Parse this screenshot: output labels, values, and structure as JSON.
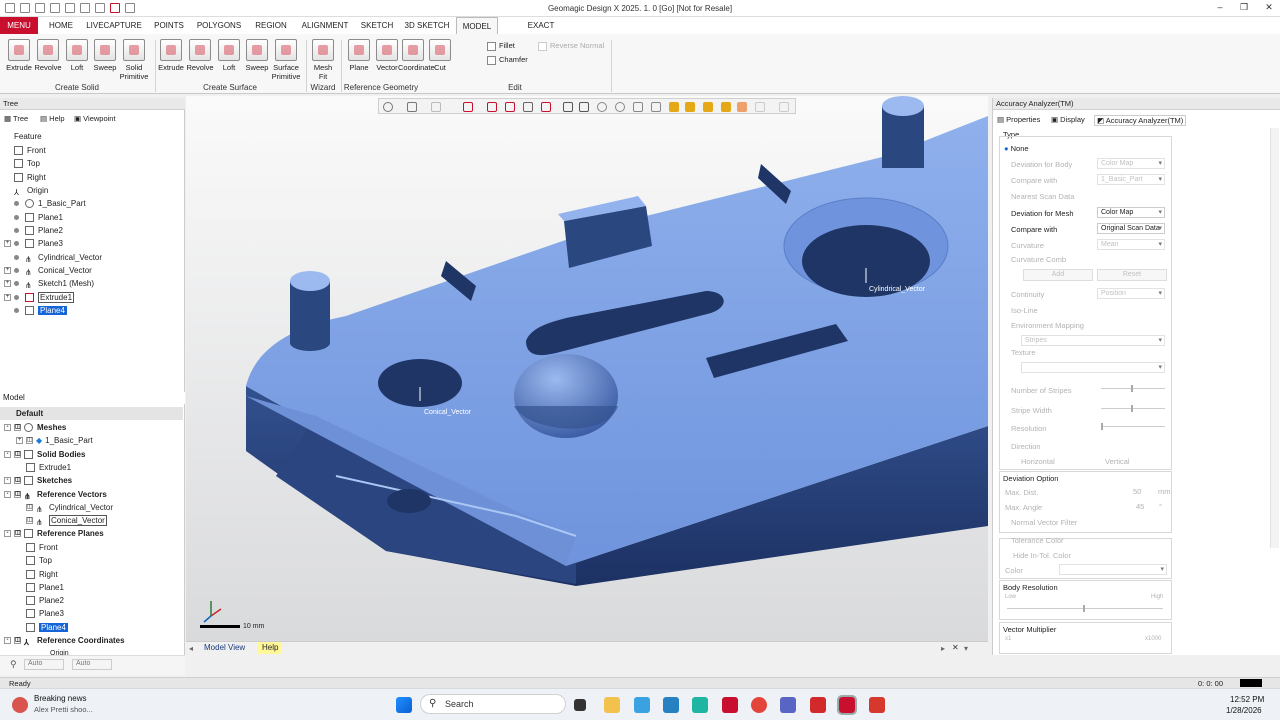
{
  "app": {
    "title": "Geomagic Design X 2025. 1. 0 [Go] [Not for Resale]",
    "window_controls": {
      "minimize": "–",
      "maximize": "❐",
      "close": "✕"
    }
  },
  "tabs": {
    "menu": "MENU",
    "items": [
      "HOME",
      "LIVECAPTURE",
      "POINTS",
      "POLYGONS",
      "REGION",
      "ALIGNMENT",
      "SKETCH",
      "3D SKETCH",
      "MODEL",
      "EXACT SURFACING"
    ],
    "active": "MODEL"
  },
  "ribbon": {
    "create_solid": {
      "label": "Create Solid",
      "buttons": [
        "Extrude",
        "Revolve",
        "Loft",
        "Sweep",
        "Solid\nPrimitive"
      ]
    },
    "create_surface": {
      "label": "Create Surface",
      "buttons": [
        "Extrude",
        "Revolve",
        "Loft",
        "Sweep",
        "Surface\nPrimitive"
      ]
    },
    "wizard": {
      "label": "Wizard",
      "buttons": [
        "Mesh\nFit"
      ]
    },
    "reference_geometry": {
      "label": "Reference Geometry",
      "buttons": [
        "Plane",
        "Vector",
        "Coordinate",
        "Cut"
      ]
    },
    "edit": {
      "label": "Edit",
      "fillet": "Fillet",
      "chamfer": "Chamfer",
      "reverse_normal": "Reverse Normal"
    }
  },
  "left_panel": {
    "title": "Tree",
    "subtabs": [
      "Tree",
      "Help",
      "Viewpoint"
    ],
    "feature_label": "Feature",
    "feature_items": [
      "Front",
      "Top",
      "Right",
      "Origin",
      "1_Basic_Part",
      "Plane1",
      "Plane2",
      "Plane3",
      "Cylindrical_Vector",
      "Conical_Vector",
      "Sketch1 (Mesh)",
      "Extrude1",
      "Plane4"
    ],
    "model_label": "Model",
    "model_items": {
      "default": "Default",
      "meshes": "Meshes",
      "mesh_child": "1_Basic_Part",
      "solid_bodies": "Solid Bodies",
      "solid_child": "Extrude1",
      "sketches": "Sketches",
      "reference_vectors": "Reference Vectors",
      "vec1": "Cylindrical_Vector",
      "vec2": "Conical_Vector",
      "reference_planes": "Reference Planes",
      "planes": [
        "Front",
        "Top",
        "Right",
        "Plane1",
        "Plane2",
        "Plane3",
        "Plane4"
      ],
      "reference_coordinates": "Reference Coordinates",
      "origin": "Origin"
    }
  },
  "viewport": {
    "label_cylindrical": "Cylindrical_Vector",
    "label_conical": "Conical_Vector",
    "scale": "10 mm",
    "tabs": [
      "Model View",
      "Help"
    ],
    "auto1": "Auto",
    "auto2": "Auto"
  },
  "right_panel": {
    "title": "Accuracy Analyzer(TM)",
    "subtabs": [
      "Properties",
      "Display",
      "Accuracy Analyzer(TM)"
    ],
    "type_label": "Type",
    "none_label": "None",
    "deviation_body": "Deviation for Body",
    "color_map_dis": "Color Map",
    "compare_with_dis": "Compare with",
    "basic_part_dis": "1_Basic_Part",
    "nearest_scan": "Nearest Scan Data",
    "deviation_mesh": "Deviation for Mesh",
    "color_map": "Color Map",
    "compare_with": "Compare with",
    "original_scan": "Original Scan Data",
    "curvature": "Curvature",
    "mean": "Mean",
    "curvature_comb": "Curvature Comb",
    "add": "Add",
    "reset": "Reset",
    "continuity": "Continuity",
    "position": "Position",
    "iso_line": "Iso-Line",
    "env_mapping": "Environment Mapping",
    "stripes": "Stripes",
    "texture": "Texture",
    "num_stripes": "Number of Stripes",
    "stripe_width": "Stripe Width",
    "resolution": "Resolution",
    "direction": "Direction",
    "horizontal": "Horizontal",
    "vertical": "Vertical",
    "deviation_option": "Deviation Option",
    "max_dist": "Max. Dist.",
    "max_dist_val": "50",
    "max_dist_unit": "mm",
    "max_angle": "Max. Angle",
    "max_angle_val": "45",
    "max_angle_unit": "°",
    "normal_vector_filter": "Normal Vector Filter",
    "tolerance_color": "Tolerance Color",
    "hide_in_tol": "Hide In-Tol. Color",
    "color": "Color",
    "body_resolution": "Body Resolution",
    "low": "Low",
    "high": "High",
    "vector_multiplier": "Vector Multiplier",
    "x1": "x1",
    "x1000": "x1000"
  },
  "status": {
    "text": "Ready",
    "time": "0: 0: 00"
  },
  "taskbar": {
    "news_title": "Breaking news",
    "news_sub": "Alex Pretti shoo...",
    "search": "Search",
    "clock_time": "12:52 PM",
    "clock_date": "1/28/2026"
  }
}
